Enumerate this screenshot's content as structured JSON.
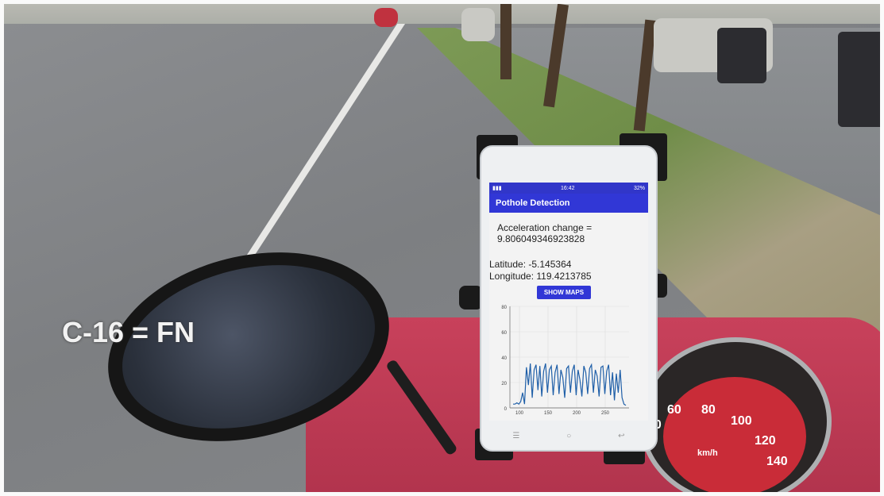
{
  "overlay": {
    "label": "C-16 = FN"
  },
  "phone": {
    "status_time": "16:42",
    "battery": "32%",
    "app_title": "Pothole Detection",
    "accel_label": "Acceleration change =",
    "accel_value": "9.806049346923828",
    "latitude": "Latitude: -5.145364",
    "longitude": "Longitude: 119.4213785",
    "show_maps_label": "SHOW MAPS"
  },
  "dashboard": {
    "speed_labels": [
      "60",
      "80",
      "100",
      "120",
      "140",
      "40"
    ],
    "unit": "km/h"
  },
  "chart_data": {
    "type": "line",
    "x_ticks": [
      "100",
      "150",
      "200",
      "250"
    ],
    "y_ticks": [
      "0",
      "20",
      "40",
      "60",
      "80"
    ],
    "ylim": [
      0,
      80
    ],
    "grid": true,
    "series": [
      {
        "values": [
          3,
          3,
          4,
          3,
          5,
          12,
          3,
          32,
          18,
          35,
          8,
          30,
          34,
          14,
          33,
          9,
          29,
          35,
          12,
          30,
          33,
          10,
          28,
          34,
          11,
          30,
          24,
          8,
          31,
          33,
          12,
          29,
          34,
          10,
          30,
          22,
          9,
          33,
          28,
          11,
          31,
          34,
          12,
          30,
          25,
          9,
          32,
          33,
          11,
          29,
          34,
          10,
          28,
          6,
          27,
          12,
          30,
          8,
          3,
          2
        ]
      }
    ]
  }
}
